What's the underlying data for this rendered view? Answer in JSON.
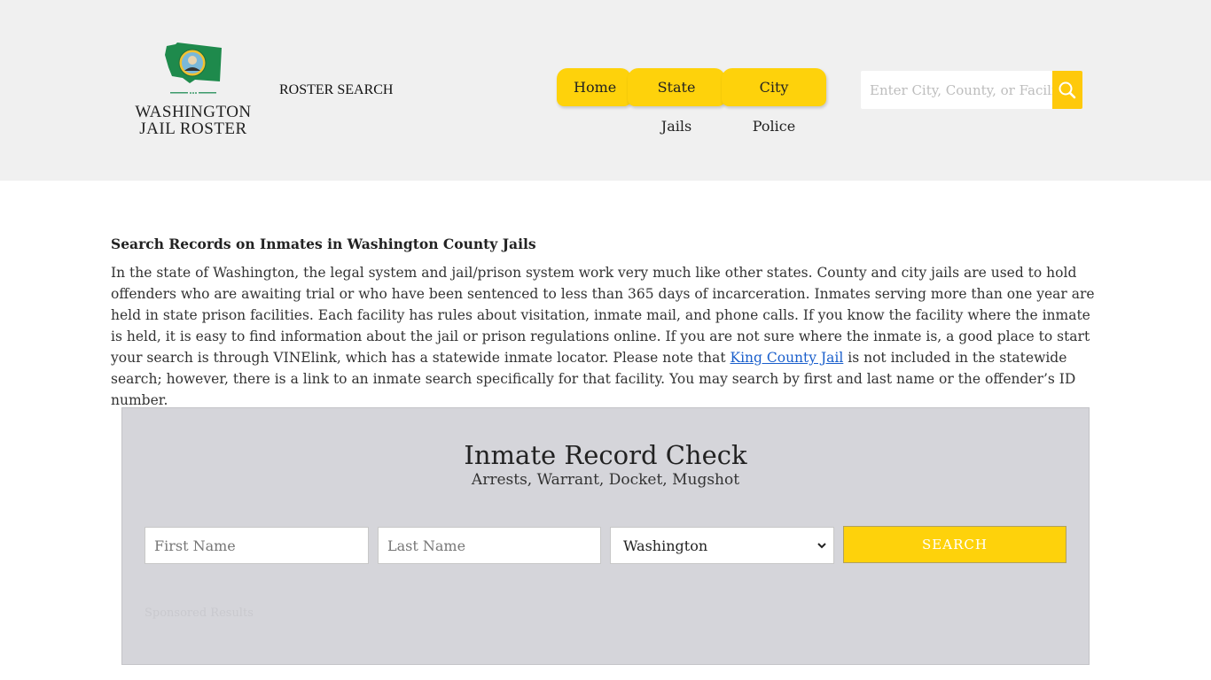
{
  "header": {
    "logo": {
      "line1": "WASHINGTON",
      "line2": "JAIL ROSTER",
      "flag_color": "#1e8a4c"
    },
    "site_label": "ROSTER SEARCH",
    "nav": [
      {
        "label": "Home"
      },
      {
        "label": "State Jails"
      },
      {
        "label": "City Police"
      }
    ],
    "search": {
      "placeholder": "Enter City, County, or Facility",
      "icon": "search-icon"
    },
    "accent_color": "#fed20b"
  },
  "main": {
    "heading": "Search Records on Inmates in Washington County Jails",
    "intro_before_link": "In the state of Washington, the legal system and jail/prison system work very much like other states. County and city jails are used to hold offenders who are awaiting trial or who have been sentenced to less than 365 days of incarceration. Inmates serving more than one year are held in state prison facilities. Each facility has rules about visitation, inmate mail, and phone calls. If you know the facility where the inmate is held, it is easy to find information about the jail or prison regulations online. If you are not sure where the inmate is, a good place to start your search is through VINElink, which has a statewide inmate locator. Please note that ",
    "intro_link": "King County Jail",
    "intro_after_link": " is not included in the statewide search; however, there is a link to an inmate search specifically for that facility. You may search by first and last name or the offender’s ID number."
  },
  "record_check": {
    "title": "Inmate Record Check",
    "subtitle": "Arrests, Warrant, Docket, Mugshot",
    "first_name_placeholder": "First Name",
    "last_name_placeholder": "Last Name",
    "state_selected": "Washington",
    "search_label": "SEARCH",
    "sponsored_label": "Sponsored Results"
  }
}
